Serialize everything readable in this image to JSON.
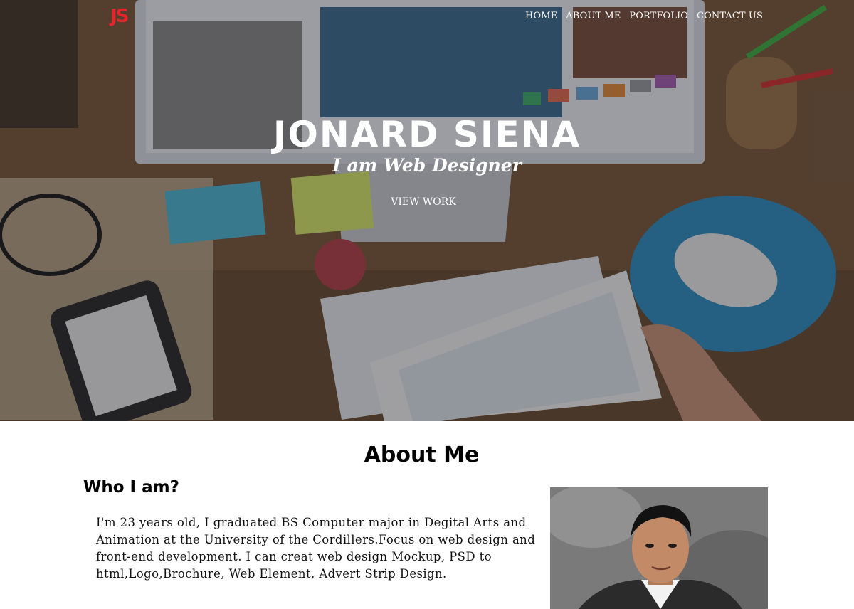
{
  "logo": {
    "text": "JS",
    "color": "#e3262c"
  },
  "nav": {
    "items": [
      "HOME",
      "ABOUT ME",
      "PORTFOLIO",
      "CONTACT US"
    ]
  },
  "hero": {
    "title": "JONARD SIENA",
    "subtitle": "I am Web Designer",
    "button_label": "VIEW WORK"
  },
  "about": {
    "heading": "About Me",
    "subheading": "Who I am?",
    "paragraph": "I'm 23 years old, I graduated BS Computer major in Degital Arts and Animation at the University of the Cordillers.Focus on  web design and front-end development.  I can creat web design Mockup, PSD to html,Logo,Brochure, Web Element, Advert Strip Design.",
    "photo_icon": "profile-photo"
  }
}
